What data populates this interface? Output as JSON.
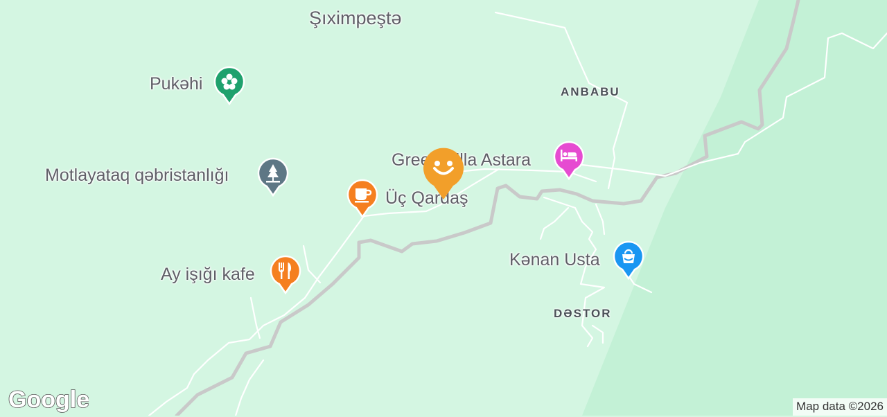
{
  "colors": {
    "land": "#d4f6e2",
    "land_darker": "#c2f0d4",
    "road_gray": "#c6c6c6",
    "road_white": "#ffffff",
    "park_pin": "#1fa16d",
    "cemetery_pin": "#5e7785",
    "cafe_pin": "#f57f20",
    "restaurant_pin": "#f57f20",
    "hotel_pin": "#e64bd1",
    "shop_pin": "#1a96f2",
    "selected_marker": "#f29f2a"
  },
  "places": {
    "village_north": "Şıximpeştə",
    "area_anbabu": "ANBABU",
    "area_dastor": "DƏSTOR"
  },
  "pois": {
    "pukahi": {
      "label": "Pukəhi",
      "icon": "flower-icon"
    },
    "motlayataq": {
      "label": "Motlayataq qəbristanlığı",
      "icon": "cemetery-icon"
    },
    "uc_qardas": {
      "label": "Üç Qardaş",
      "icon": "coffee-cup-icon"
    },
    "ay_isigi": {
      "label": "Ay işığı kafe",
      "icon": "fork-knife-icon"
    },
    "green_villa": {
      "label": "Green Villa Astara",
      "icon": "bed-icon"
    },
    "kanan_usta": {
      "label": "Kənan Usta",
      "icon": "shopping-bag-icon"
    }
  },
  "selected_marker": {
    "icon": "smiley-icon"
  },
  "footer": {
    "logo": "Google",
    "attribution": "Map data ©2026"
  }
}
